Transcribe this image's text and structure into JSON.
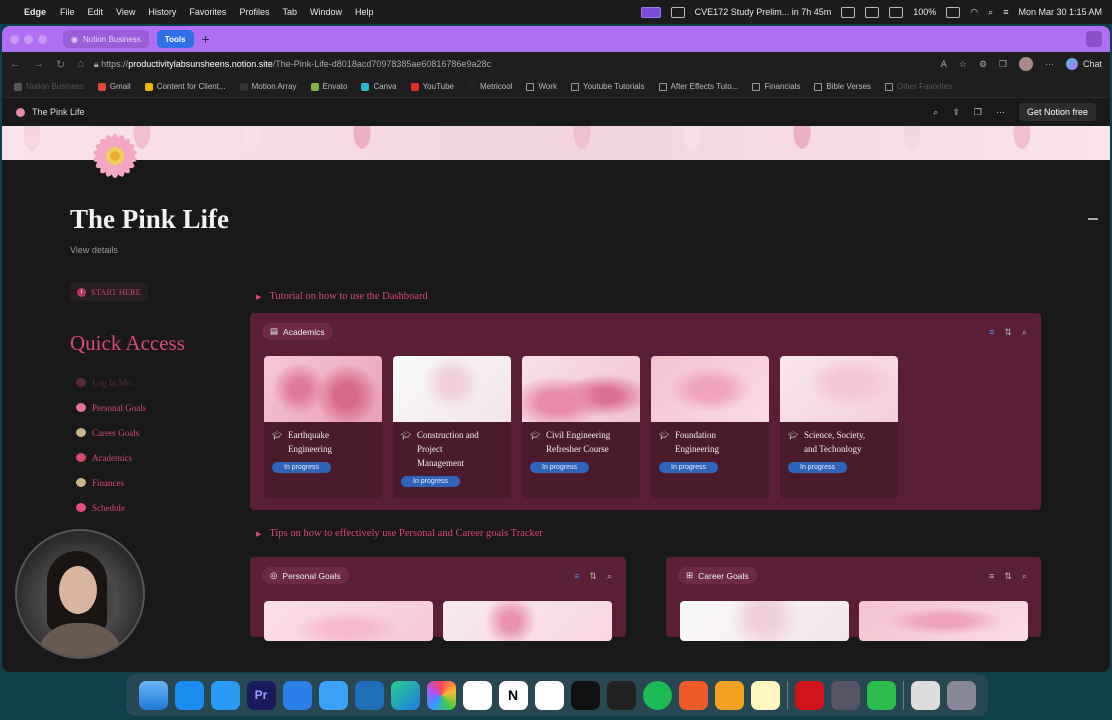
{
  "menubar": {
    "app": "Edge",
    "items": [
      "File",
      "Edit",
      "View",
      "History",
      "Favorites",
      "Profiles",
      "Tab",
      "Window",
      "Help"
    ],
    "timer": "CVE172 Study Prelim... in 7h 45m",
    "battery": "100%",
    "datetime": "Mon Mar 30  1:15 AM"
  },
  "browser": {
    "workspace_tab": "Notion Business",
    "active_tab": "Tools",
    "url_host": "productivitylabsunsheens.notion.site",
    "url_prefix": "https://",
    "url_path": "/The-Pink-Life-d8018acd70978385ae60816786e9a28c",
    "chat_label": "Chat"
  },
  "bookmarks": [
    {
      "label": "Notion Business",
      "color": "#555",
      "dim": true
    },
    {
      "label": "Gmail",
      "color": "#e04a3c"
    },
    {
      "label": "Content for Client...",
      "color": "#f3b400"
    },
    {
      "label": "Motion Array",
      "color": "#333"
    },
    {
      "label": "Envato",
      "color": "#82b541"
    },
    {
      "label": "Canva",
      "color": "#2ab6d6"
    },
    {
      "label": "YouTube",
      "color": "#e52d27"
    },
    {
      "label": "Metricool",
      "color": "#222"
    },
    {
      "label": "Work",
      "color": "folder"
    },
    {
      "label": "Youtube Tutorials",
      "color": "folder"
    },
    {
      "label": "After Effects Tuto...",
      "color": "folder"
    },
    {
      "label": "Financials",
      "color": "folder"
    },
    {
      "label": "Bible Verses",
      "color": "folder"
    },
    {
      "label": "Other Favorites",
      "color": "folder",
      "dim": true
    }
  ],
  "notion": {
    "breadcrumb": "The Pink Life",
    "get_free": "Get Notion free"
  },
  "page": {
    "title": "The Pink Life",
    "view_details": "View details",
    "start_here": "START HERE",
    "quick_access_title": "Quick Access",
    "quick_access": [
      {
        "label": "Log In Mo...",
        "color": "#5a2a38",
        "faded": true
      },
      {
        "label": "Personal Goals",
        "color": "#e86fa0"
      },
      {
        "label": "Career Goals",
        "color": "#c8b48a"
      },
      {
        "label": "Academics",
        "color": "#d44a6a"
      },
      {
        "label": "Finances",
        "color": "#c8b48a"
      },
      {
        "label": "Schedule",
        "color": "#e0507a"
      }
    ],
    "toggle_dashboard": "Tutorial on how to use the Dashboard",
    "toggle_tips": "Tips on how to effectively use Personal and Career goals Tracker"
  },
  "academics": {
    "title": "Academics",
    "cards": [
      {
        "name_lines": [
          "Earthquake",
          "Engineering"
        ],
        "status": "In progress"
      },
      {
        "name_lines": [
          "Construction and",
          "Project",
          "Management"
        ],
        "status": "In progress"
      },
      {
        "name_lines": [
          "Civil Engineering",
          "Refresher Course"
        ],
        "status": "In progress"
      },
      {
        "name_lines": [
          "Foundation",
          "Engineering"
        ],
        "status": "In progress"
      },
      {
        "name_lines": [
          "Science, Society,",
          "and Techonlogy"
        ],
        "status": "In progress"
      }
    ]
  },
  "personal_goals": {
    "title": "Personal Goals"
  },
  "career_goals": {
    "title": "Career Goals"
  },
  "colors": {
    "accent_pink": "#d8487a",
    "db_bg": "#5a1f36",
    "badge_blue": "#2f64b8",
    "tab_purple": "#b06ff2"
  }
}
